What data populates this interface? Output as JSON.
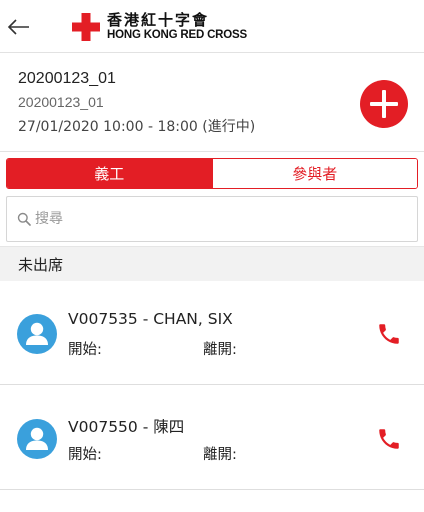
{
  "header": {
    "logo_zh": "香港紅十字會",
    "logo_en": "HONG KONG RED CROSS",
    "back_icon": "arrow-left-icon"
  },
  "event": {
    "title": "20200123_01",
    "subtitle": "20200123_01",
    "time": "27/01/2020 10:00 - 18:00 (進行中)",
    "add_icon": "plus-circle-icon"
  },
  "tabs": [
    {
      "label": "義工",
      "active": true
    },
    {
      "label": "參與者",
      "active": false
    }
  ],
  "search": {
    "placeholder": "搜尋",
    "value": ""
  },
  "section": {
    "title": "未出席"
  },
  "people": [
    {
      "name": "V007535 - CHAN, SIX",
      "start_label": "開始:",
      "end_label": "離開:"
    },
    {
      "name": "V007550 - 陳四",
      "start_label": "開始:",
      "end_label": "離開:"
    }
  ],
  "colors": {
    "brand_red": "#e31e25",
    "avatar_blue": "#3aa0dc"
  }
}
